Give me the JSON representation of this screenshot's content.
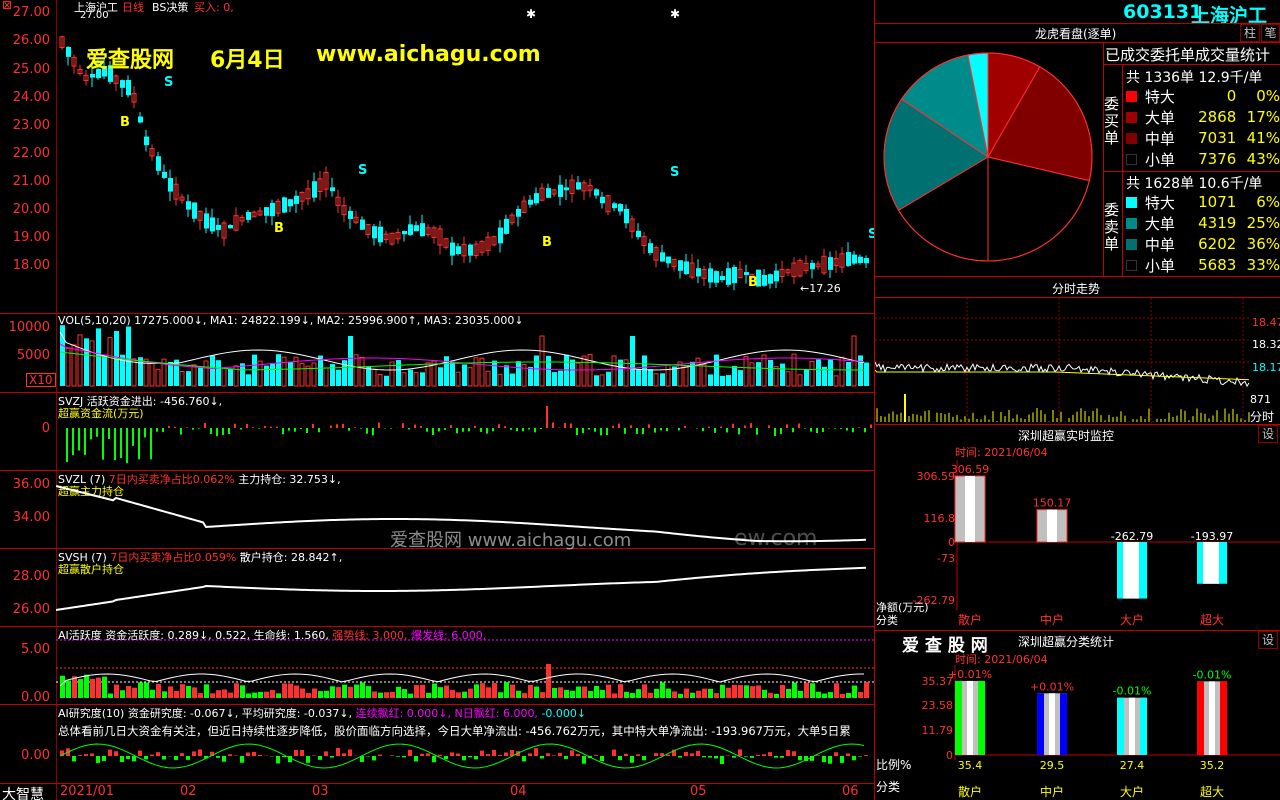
{
  "header": {
    "stock_name": "上海沪工",
    "period": "日线",
    "strategy": "BS决策",
    "buy_label": "买入: 0,",
    "high_price_label": "27.00"
  },
  "watermark": {
    "site": "爱查股网",
    "date": "6月4日",
    "url": "www.aichagu.com",
    "center_text": "爱查股网  www.aichagu.com",
    "center_suffix": "ew.com"
  },
  "main_chart": {
    "y_ticks": [
      "27.00",
      "26.00",
      "25.00",
      "24.00",
      "23.00",
      "22.00",
      "21.00",
      "20.00",
      "19.00",
      "18.00"
    ],
    "low_label": "←17.26",
    "signals": [
      "B",
      "S",
      "B",
      "S",
      "B",
      "S",
      "B",
      "S"
    ]
  },
  "vol_panel": {
    "title": "VOL(5,10,20) 17275.000↓, MA1: 24822.199↓, MA2: 25996.900↑, MA3: 23035.000↓",
    "y_ticks": [
      "10000",
      "5000"
    ],
    "unit": "X10"
  },
  "svzj_panel": {
    "title": "SVZJ  活跃资金进出: -456.760↓,",
    "subtitle": "超赢资金流(万元)",
    "y_tick": "0"
  },
  "svzl_panel": {
    "title_a": "SVZL (7)",
    "title_b": "7日内买卖净占比0.062%",
    "title_c": "主力持仓: 32.753↓,",
    "subtitle": "超赢主力持仓",
    "y_ticks": [
      "36.00",
      "34.00"
    ]
  },
  "svsh_panel": {
    "title_a": "SVSH (7)",
    "title_b": "7日内买卖净占比0.059%",
    "title_c": "散户持仓: 28.842↑,",
    "subtitle": "超赢散户持仓",
    "y_ticks": [
      "28.00",
      "26.00"
    ]
  },
  "ai_active_panel": {
    "title": "AI活跃度 资金活跃度: 0.289↓, 0.522, 生命线: 1.560,",
    "strong": "强势线: 3.000,",
    "burst": "爆发线: 6.000,",
    "y_ticks": [
      "5.00",
      "0.00"
    ]
  },
  "ai_research_panel": {
    "title": "AI研究度(10) 资金研究度: -0.067↓, 平均研究度: -0.037↓,",
    "streak": "连续飘红: 0.000↓,",
    "nday": "N日飘红: 6.000,",
    "tail": "-0.000↓",
    "summary": "总体看前几日大资金有关注，但近日持续性逐步降低，股价面临方向选择，今日大单净流出: -456.762万元，其中特大单净流出: -193.967万元，大单5日累",
    "y_tick": "0.00"
  },
  "x_axis": {
    "brand": "大智慧",
    "labels": [
      "2021/01",
      "02",
      "03",
      "04",
      "05",
      "06"
    ]
  },
  "right_panel": {
    "code": "603131",
    "name": "上海沪工",
    "btn_column": "柱",
    "btn_note": "笔",
    "dragon_title": "龙虎看盘(逐单)",
    "stats_title": "已成交委托单成交量统计",
    "buy_total": "共 1336单 12.9千/单",
    "buy_label": "委买单",
    "buy_rows": [
      {
        "name": "特大",
        "val": "0",
        "pct": "0%",
        "color": "#ff0000"
      },
      {
        "name": "大单",
        "val": "2868",
        "pct": "17%",
        "color": "#a00000"
      },
      {
        "name": "中单",
        "val": "7031",
        "pct": "41%",
        "color": "#800000"
      },
      {
        "name": "小单",
        "val": "7376",
        "pct": "43%",
        "color": "#000000"
      }
    ],
    "sell_total": "共 1628单 10.6千/单",
    "sell_label": "委卖单",
    "sell_rows": [
      {
        "name": "特大",
        "val": "1071",
        "pct": "6%",
        "color": "#00ffff"
      },
      {
        "name": "大单",
        "val": "4319",
        "pct": "25%",
        "color": "#008b8b"
      },
      {
        "name": "中单",
        "val": "6202",
        "pct": "36%",
        "color": "#007070"
      },
      {
        "name": "小单",
        "val": "5683",
        "pct": "33%",
        "color": "#000000"
      }
    ],
    "intraday_title": "分时走势",
    "intraday_prices": [
      "18.47",
      "18.32",
      "18.17"
    ],
    "intraday_vol": "871",
    "intraday_vol_label": "分时",
    "monitor_title": "深圳超赢实时监控",
    "monitor_btn": "设",
    "monitor_time": "时间: 2021/06/04",
    "monitor_axis": [
      "306.59",
      "116.8",
      "0",
      "-73",
      "-262.79"
    ],
    "monitor_unit": "净额(万元)",
    "monitor_cat_label": "分类",
    "monitor_bars": [
      {
        "label": "散户",
        "value": "306.59"
      },
      {
        "label": "中户",
        "value": "150.17"
      },
      {
        "label": "大户",
        "value": "-262.79"
      },
      {
        "label": "超大",
        "value": "-193.97"
      }
    ],
    "stats2_brand": "爱 查 股 网",
    "stats2_title": "深圳超赢分类统计",
    "stats2_btn": "设",
    "stats2_time": "时间: 2021/06/04",
    "stats2_axis": [
      "35.37",
      "23.58",
      "11.79",
      "0"
    ],
    "stats2_ratio": "比例%",
    "stats2_cat": "分类",
    "stats2_bars": [
      {
        "label": "散户",
        "change": "+0.01%",
        "value": "35.4",
        "color": "#00ff00"
      },
      {
        "label": "中户",
        "change": "+0.01%",
        "value": "29.5",
        "color": "#0000ff"
      },
      {
        "label": "大户",
        "change": "-0.01%",
        "value": "27.4",
        "color": "#00ffff"
      },
      {
        "label": "超大",
        "change": "-0.01%",
        "value": "35.2",
        "color": "#ff0000"
      }
    ]
  },
  "chart_data": {
    "type": "pie",
    "title": "龙虎看盘(逐单)",
    "series": [
      {
        "name": "委买单",
        "values": [
          0,
          2868,
          7031,
          7376
        ],
        "categories": [
          "特大",
          "大单",
          "中单",
          "小单"
        ]
      },
      {
        "name": "委卖单",
        "values": [
          1071,
          4319,
          6202,
          5683
        ],
        "categories": [
          "特大",
          "大单",
          "中单",
          "小单"
        ]
      }
    ]
  }
}
